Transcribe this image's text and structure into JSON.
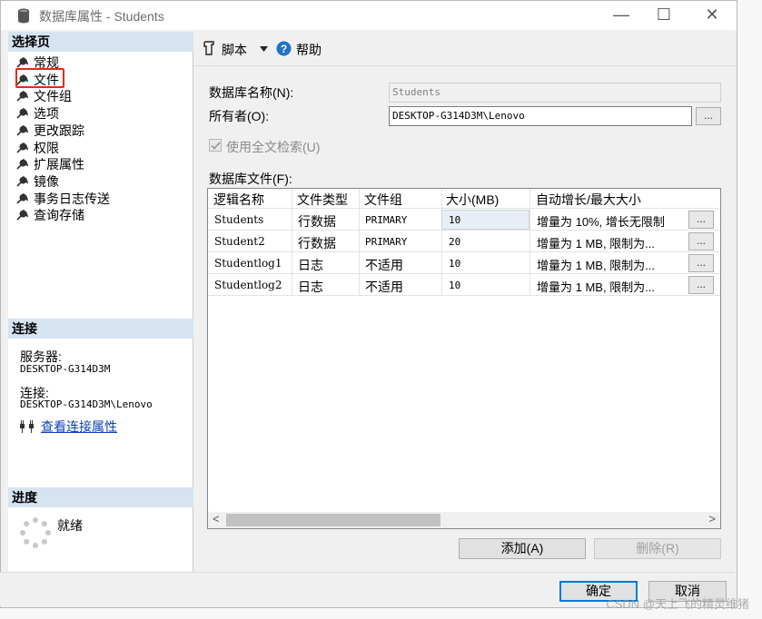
{
  "window": {
    "title": "数据库属性 - Students",
    "minimize_glyph": "—",
    "maximize_glyph": "☐",
    "close_glyph": "✕"
  },
  "sidebar": {
    "select_page_header": "选择页",
    "items": [
      {
        "label": "常规",
        "icon": "wrench-icon"
      },
      {
        "label": "文件",
        "icon": "wrench-icon"
      },
      {
        "label": "文件组",
        "icon": "wrench-icon"
      },
      {
        "label": "选项",
        "icon": "wrench-icon"
      },
      {
        "label": "更改跟踪",
        "icon": "wrench-icon"
      },
      {
        "label": "权限",
        "icon": "wrench-icon"
      },
      {
        "label": "扩展属性",
        "icon": "wrench-icon"
      },
      {
        "label": "镜像",
        "icon": "wrench-icon"
      },
      {
        "label": "事务日志传送",
        "icon": "wrench-icon"
      },
      {
        "label": "查询存储",
        "icon": "wrench-icon"
      }
    ],
    "selected_index": 1,
    "connection_header": "连接",
    "server_label": "服务器:",
    "server_value": "DESKTOP-G314D3M",
    "connection_label": "连接:",
    "connection_value": "DESKTOP-G314D3M\\Lenovo",
    "view_connection_link": "查看连接属性",
    "progress_header": "进度",
    "progress_status": "就绪"
  },
  "toolbar": {
    "script_label": "脚本",
    "help_label": "帮助"
  },
  "form": {
    "db_name_label": "数据库名称(N):",
    "db_name_value": "Students",
    "owner_label": "所有者(O):",
    "owner_value": "DESKTOP-G314D3M\\Lenovo",
    "owner_browse": "...",
    "fulltext_label": "使用全文检索(U)",
    "fulltext_checked": true,
    "db_files_label": "数据库文件(F):"
  },
  "files_table": {
    "columns": [
      "逻辑名称",
      "文件类型",
      "文件组",
      "大小(MB)",
      "自动增长/最大大小"
    ],
    "rows": [
      {
        "name": "Students",
        "type": "行数据",
        "group": "PRIMARY",
        "size": "10",
        "growth": "增量为 10%, 增长无限制",
        "browse": "..."
      },
      {
        "name": "Student2",
        "type": "行数据",
        "group": "PRIMARY",
        "size": "20",
        "growth": "增量为 1 MB, 限制为...",
        "browse": "..."
      },
      {
        "name": "Studentlog1",
        "type": "日志",
        "group": "不适用",
        "size": "10",
        "growth": "增量为 1 MB, 限制为...",
        "browse": "..."
      },
      {
        "name": "Studentlog2",
        "type": "日志",
        "group": "不适用",
        "size": "10",
        "growth": "增量为 1 MB, 限制为...",
        "browse": "..."
      }
    ],
    "scroll_left": "<",
    "scroll_right": ">"
  },
  "buttons": {
    "add": "添加(A)",
    "remove": "删除(R)",
    "ok": "确定",
    "cancel": "取消"
  },
  "watermark": "CSDN @天上飞的精灵维猪",
  "colors": {
    "section_header_bg": "#d6e4f2",
    "highlight_border": "#e5281e",
    "link": "#0b42b5",
    "default_button_border": "#0078d7"
  }
}
